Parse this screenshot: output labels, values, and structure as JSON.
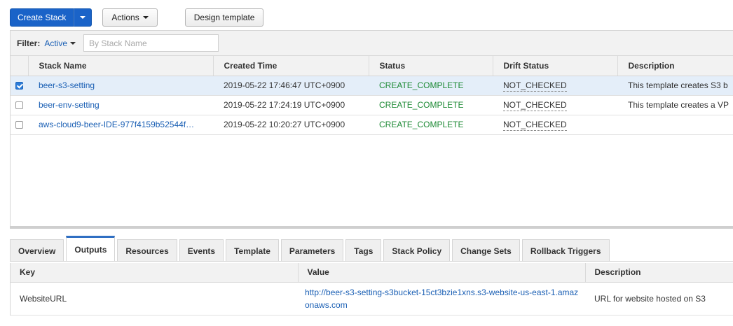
{
  "toolbar": {
    "create_stack_label": "Create Stack",
    "actions_label": "Actions",
    "design_template_label": "Design template"
  },
  "filter": {
    "label": "Filter:",
    "active_value": "Active",
    "search_placeholder": "By Stack Name"
  },
  "stacks": {
    "columns": [
      "Stack Name",
      "Created Time",
      "Status",
      "Drift Status",
      "Description"
    ],
    "rows": [
      {
        "name": "beer-s3-setting",
        "created": "2019-05-22 17:46:47 UTC+0900",
        "status": "CREATE_COMPLETE",
        "drift": "NOT_CHECKED",
        "description": "This template creates S3 b",
        "selected": true
      },
      {
        "name": "beer-env-setting",
        "created": "2019-05-22 17:24:19 UTC+0900",
        "status": "CREATE_COMPLETE",
        "drift": "NOT_CHECKED",
        "description": "This template creates a VP",
        "selected": false
      },
      {
        "name": "aws-cloud9-beer-IDE-977f4159b52544f…",
        "created": "2019-05-22 10:20:27 UTC+0900",
        "status": "CREATE_COMPLETE",
        "drift": "NOT_CHECKED",
        "description": "",
        "selected": false
      }
    ]
  },
  "tabs": [
    {
      "label": "Overview",
      "active": false
    },
    {
      "label": "Outputs",
      "active": true
    },
    {
      "label": "Resources",
      "active": false
    },
    {
      "label": "Events",
      "active": false
    },
    {
      "label": "Template",
      "active": false
    },
    {
      "label": "Parameters",
      "active": false
    },
    {
      "label": "Tags",
      "active": false
    },
    {
      "label": "Stack Policy",
      "active": false
    },
    {
      "label": "Change Sets",
      "active": false
    },
    {
      "label": "Rollback Triggers",
      "active": false
    }
  ],
  "outputs": {
    "columns": [
      "Key",
      "Value",
      "Description"
    ],
    "rows": [
      {
        "key": "WebsiteURL",
        "value": "http://beer-s3-setting-s3bucket-15ct3bzie1xns.s3-website-us-east-1.amazonaws.com",
        "description": "URL for website hosted on S3"
      }
    ]
  },
  "colors": {
    "primary": "#1a63c8",
    "link": "#1a5fb4",
    "status_complete": "#1d8a35",
    "selected_row": "#e4eef9"
  },
  "icons": {
    "dropdown": "caret-down-icon",
    "checkbox_checked": "checkbox-checked-icon",
    "checkbox_unchecked": "checkbox-unchecked-icon"
  }
}
